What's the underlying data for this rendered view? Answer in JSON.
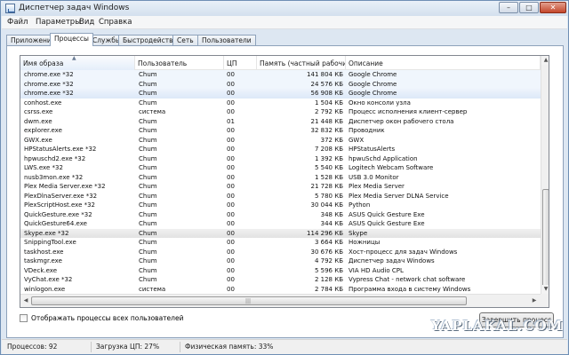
{
  "window": {
    "title": "Диспетчер задач Windows",
    "controls": {
      "minimize": "–",
      "maximize": "□",
      "close": "✕"
    }
  },
  "menu": [
    "Файл",
    "Параметры",
    "Вид",
    "Справка"
  ],
  "tabs": [
    {
      "label": "Приложения",
      "active": false
    },
    {
      "label": "Процессы",
      "active": true
    },
    {
      "label": "Службы",
      "active": false
    },
    {
      "label": "Быстродействие",
      "active": false
    },
    {
      "label": "Сеть",
      "active": false
    },
    {
      "label": "Пользователи",
      "active": false
    }
  ],
  "table": {
    "columns": [
      "Имя образа",
      "Пользователь",
      "ЦП",
      "Память (частный рабочий набор)",
      "Описание"
    ],
    "sorted_column": "Имя образа",
    "rows": [
      [
        "chrome.exe *32",
        "Chum",
        "00",
        "141 804 КБ",
        "Google Chrome"
      ],
      [
        "chrome.exe *32",
        "Chum",
        "00",
        "24 576 КБ",
        "Google Chrome"
      ],
      [
        "chrome.exe *32",
        "Chum",
        "00",
        "56 908 КБ",
        "Google Chrome"
      ],
      [
        "conhost.exe",
        "Chum",
        "00",
        "1 504 КБ",
        "Окно консоли узла"
      ],
      [
        "csrss.exe",
        "система",
        "00",
        "2 792 КБ",
        "Процесс исполнения клиент-сервер"
      ],
      [
        "dwm.exe",
        "Chum",
        "01",
        "21 448 КБ",
        "Диспетчер окон рабочего стола"
      ],
      [
        "explorer.exe",
        "Chum",
        "00",
        "32 832 КБ",
        "Проводник"
      ],
      [
        "GWX.exe",
        "Chum",
        "00",
        "372 КБ",
        "GWX"
      ],
      [
        "HPStatusAlerts.exe *32",
        "Chum",
        "00",
        "7 208 КБ",
        "HPStatusAlerts"
      ],
      [
        "hpwuschd2.exe *32",
        "Chum",
        "00",
        "1 392 КБ",
        "hpwuSchd Application"
      ],
      [
        "LWS.exe *32",
        "Chum",
        "00",
        "5 540 КБ",
        "Logitech Webcam Software"
      ],
      [
        "nusb3mon.exe *32",
        "Chum",
        "00",
        "1 528 КБ",
        "USB 3.0 Monitor"
      ],
      [
        "Plex Media Server.exe *32",
        "Chum",
        "00",
        "21 728 КБ",
        "Plex Media Server"
      ],
      [
        "PlexDlnaServer.exe *32",
        "Chum",
        "00",
        "5 780 КБ",
        "Plex Media Server DLNA Service"
      ],
      [
        "PlexScriptHost.exe *32",
        "Chum",
        "00",
        "30 044 КБ",
        "Python"
      ],
      [
        "QuickGesture.exe *32",
        "Chum",
        "00",
        "348 КБ",
        "ASUS Quick Gesture Exe"
      ],
      [
        "QuickGesture64.exe",
        "Chum",
        "00",
        "344 КБ",
        "ASUS Quick Gesture Exe"
      ],
      [
        "Skype.exe *32",
        "Chum",
        "00",
        "114 296 КБ",
        "Skype"
      ],
      [
        "SnippingTool.exe",
        "Chum",
        "00",
        "3 664 КБ",
        "Ножницы"
      ],
      [
        "taskhost.exe",
        "Chum",
        "00",
        "30 676 КБ",
        "Хост-процесс для задач Windows"
      ],
      [
        "taskmgr.exe",
        "Chum",
        "00",
        "4 792 КБ",
        "Диспетчер задач Windows"
      ],
      [
        "VDeck.exe",
        "Chum",
        "00",
        "5 596 КБ",
        "VIA HD Audio CPL"
      ],
      [
        "VyChat.exe *32",
        "Chum",
        "00",
        "2 128 КБ",
        "Vypress Chat - network chat software"
      ],
      [
        "winlogon.exe",
        "система",
        "00",
        "2 784 КБ",
        "Программа входа в систему Windows"
      ]
    ]
  },
  "show_all_users": {
    "label": "Отображать процессы всех пользователей",
    "checked": false
  },
  "end_process_button": "Завершить процесс",
  "status": {
    "processes": "Процессов: 92",
    "cpu": "Загрузка ЦП: 27%",
    "memory": "Физическая память: 33%"
  },
  "watermark": "YAPLAKAL.COM",
  "icons": {
    "app": "task-manager-icon",
    "sort": "sort-ascending-icon",
    "scroll_up": "arrow-up-icon",
    "scroll_down": "arrow-down-icon",
    "scroll_left": "arrow-left-icon",
    "scroll_right": "arrow-right-icon"
  },
  "colors": {
    "window_frame": "#dde7f2",
    "selected_row": "#dce9f8",
    "highlighted_row": "#e2e2e2"
  }
}
